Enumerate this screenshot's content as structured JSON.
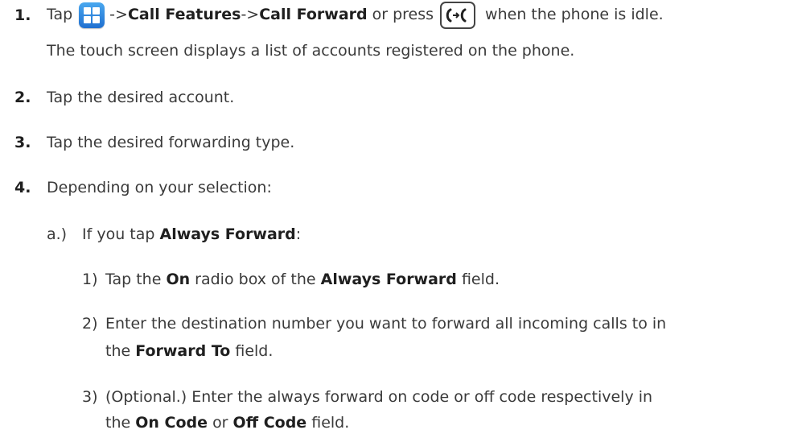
{
  "steps": [
    {
      "number": "1.",
      "text_tap": "Tap",
      "arrow1": "->",
      "call_features": "Call Features",
      "arrow2": "->",
      "call_forward": "Call Forward",
      "or_press": "or press",
      "when_idle": "when the phone is idle.",
      "detail": "The touch screen displays a list of accounts registered on the phone.",
      "icons": [
        "menu-icon",
        "forward-key-icon"
      ]
    },
    {
      "number": "2.",
      "text": "Tap the desired account."
    },
    {
      "number": "3.",
      "text": "Tap the desired forwarding type."
    },
    {
      "number": "4.",
      "text": "Depending on your selection:"
    }
  ],
  "sub_a": {
    "label": "a.)",
    "prefix": "If you tap",
    "bold": "Always Forward",
    "suffix": ":"
  },
  "sub_steps": [
    {
      "label": "1)",
      "p1": "Tap the",
      "b1": "On",
      "p2": "radio box of the",
      "b2": "Always Forward",
      "p3": "field."
    },
    {
      "label": "2)",
      "line1": "Enter the destination number you want to forward all incoming calls to in",
      "p1": "the",
      "b1": "Forward To",
      "p2": "field."
    },
    {
      "label": "3)",
      "line1": "(Optional.) Enter the always forward on code or off code respectively in",
      "p1": "the",
      "b1": "On Code",
      "p2": "or",
      "b2": "Off Code",
      "p3": "field."
    }
  ]
}
